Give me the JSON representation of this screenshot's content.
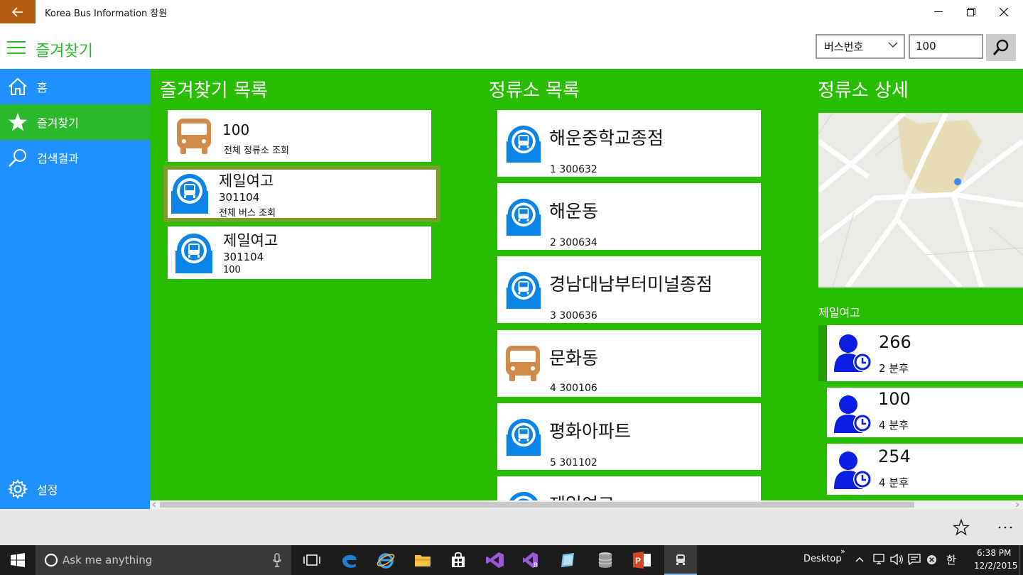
{
  "window": {
    "title": "Korea Bus Information 창원"
  },
  "header": {
    "title": "즐겨찾기",
    "search_type": "버스번호",
    "search_value": "100"
  },
  "sidebar": {
    "items": [
      {
        "label": "홈"
      },
      {
        "label": "즐겨찾기"
      },
      {
        "label": "검색결과"
      }
    ],
    "settings_label": "설정"
  },
  "favorites": {
    "title": "즐겨찾기 목록",
    "items": [
      {
        "title": "100",
        "line1": "전체 정류소 조회",
        "line2": "",
        "icon": "bus-icon"
      },
      {
        "title": "제일여고",
        "line1": "301104",
        "line2": "전체 버스 조회",
        "icon": "bus-stop-icon"
      },
      {
        "title": "제일여고",
        "line1": "301104",
        "line2": "100",
        "icon": "bus-stop-icon"
      }
    ]
  },
  "stops": {
    "title": "정류소 목록",
    "items": [
      {
        "name": "해운중학교종점",
        "sub": "1 300632",
        "icon": "bus-stop-icon"
      },
      {
        "name": "해운동",
        "sub": "2 300634",
        "icon": "bus-stop-icon"
      },
      {
        "name": "경남대남부터미널종점",
        "sub": "3 300636",
        "icon": "bus-stop-icon"
      },
      {
        "name": "문화동",
        "sub": "4 300106",
        "icon": "bus-icon"
      },
      {
        "name": "평화아파트",
        "sub": "5 301102",
        "icon": "bus-stop-icon"
      },
      {
        "name": "제일여고",
        "sub": "",
        "icon": "bus-stop-icon"
      }
    ]
  },
  "detail": {
    "title": "정류소 상세",
    "stop_name": "제일여고",
    "arrivals": [
      {
        "bus": "266",
        "eta": "2 분후"
      },
      {
        "bus": "100",
        "eta": "4 분후"
      },
      {
        "bus": "254",
        "eta": "4 분후"
      }
    ]
  },
  "taskbar": {
    "search_placeholder": "Ask me anything",
    "desktop_label": "Desktop",
    "time": "6:38 PM",
    "date": "12/2/2015",
    "ime": "한"
  },
  "colors": {
    "accent_green": "#29bd00",
    "sidebar_blue": "#1e90ff",
    "bus_orange": "#d08a4a",
    "stop_blue": "#0a84e6",
    "person_blue": "#0a1ee6"
  }
}
